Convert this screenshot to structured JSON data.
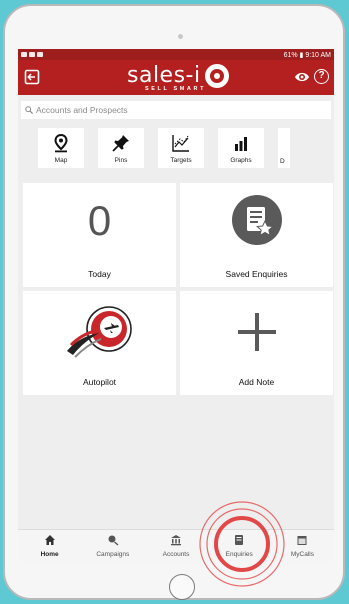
{
  "status_bar": {
    "right_text": "61% ▮ 9:10 AM"
  },
  "app_bar": {
    "logo_text": "sales-i",
    "logo_tagline": "SELL SMART",
    "help_symbol": "?"
  },
  "search": {
    "placeholder": "Accounts and Prospects"
  },
  "shortcuts": [
    {
      "label": "Map",
      "icon": "map-pin-icon"
    },
    {
      "label": "Pins",
      "icon": "pushpin-icon"
    },
    {
      "label": "Targets",
      "icon": "targets-chart-icon"
    },
    {
      "label": "Graphs",
      "icon": "bar-graph-icon"
    },
    {
      "label": "D",
      "icon": "partial-shortcut-icon"
    }
  ],
  "tiles": {
    "today": {
      "value": "0",
      "label": "Today"
    },
    "saved": {
      "label": "Saved Enquiries"
    },
    "autopilot": {
      "label": "Autopilot"
    },
    "add_note": {
      "label": "Add Note"
    }
  },
  "bottom_nav": [
    {
      "label": "Home",
      "icon": "home-icon"
    },
    {
      "label": "Campaigns",
      "icon": "campaigns-icon"
    },
    {
      "label": "Accounts",
      "icon": "bank-icon"
    },
    {
      "label": "Enquiries",
      "icon": "enquiries-icon"
    },
    {
      "label": "MyCalls",
      "icon": "calendar-icon"
    }
  ],
  "colors": {
    "brand_red": "#b4201f",
    "status_red": "#9e1d1d",
    "background_teal": "#5ec8d3",
    "tap_ring": "#e34848"
  }
}
